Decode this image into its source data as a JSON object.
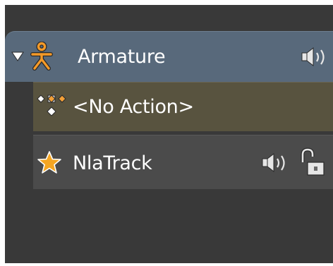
{
  "tree": {
    "armature": {
      "label": "Armature",
      "icons": [
        "disclosure-triangle-down-icon",
        "armature-icon",
        "speaker-icon"
      ]
    },
    "action": {
      "label": "<No Action>",
      "icons": [
        "action-keyframes-icon"
      ]
    },
    "nla_track": {
      "label": "NlaTrack",
      "icons": [
        "star-icon",
        "speaker-icon",
        "lock-open-icon"
      ]
    }
  },
  "colors": {
    "panel_bg": "#393939",
    "armature_row": "#58697b",
    "action_row": "#58533f",
    "nla_row": "#4b4b4b",
    "armature_icon": "#f59a28",
    "star_icon": "#f5a623"
  }
}
